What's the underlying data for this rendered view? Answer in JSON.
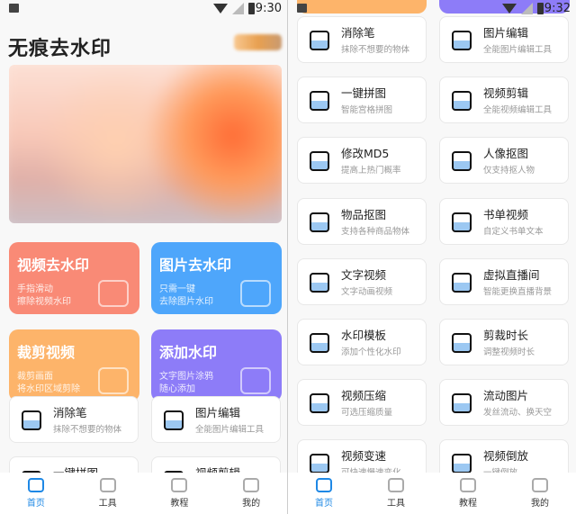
{
  "left": {
    "time": "9:30",
    "title": "无痕去水印"
  },
  "right": {
    "time": "9:32"
  },
  "features": [
    {
      "title": "视频去水印",
      "sub": "手指滑动\n擦除视频水印",
      "icon": "film-reel-icon",
      "color": "#f98a76"
    },
    {
      "title": "图片去水印",
      "sub": "只需一键\n去除图片水印",
      "icon": "image-icon",
      "color": "#4ea6fb"
    },
    {
      "title": "裁剪视频",
      "sub": "裁剪画面\n将水印区域剪除",
      "icon": "scissors-icon",
      "color": "#fdb46a"
    },
    {
      "title": "添加水印",
      "sub": "文字图片涂鸦\n随心添加",
      "icon": "pen-icon",
      "color": "#8d7cf8"
    }
  ],
  "tools": [
    {
      "name": "消除笔",
      "sub": "抹除不想要的物体",
      "icon": "eraser-icon"
    },
    {
      "name": "图片编辑",
      "sub": "全能图片编辑工具",
      "icon": "image-edit-icon"
    },
    {
      "name": "一键拼图",
      "sub": "智能宫格拼图",
      "icon": "collage-icon"
    },
    {
      "name": "视频剪辑",
      "sub": "全能视频编辑工具",
      "icon": "video-cut-icon"
    },
    {
      "name": "修改MD5",
      "sub": "提高上热门概率",
      "icon": "md5-icon"
    },
    {
      "name": "人像抠图",
      "sub": "仅支持抠人物",
      "icon": "portrait-icon"
    },
    {
      "name": "物品抠图",
      "sub": "支持各种商品物体",
      "icon": "bag-icon"
    },
    {
      "name": "书单视频",
      "sub": "自定义书单文本",
      "icon": "book-icon"
    },
    {
      "name": "文字视频",
      "sub": "文字动画视频",
      "icon": "text-video-icon"
    },
    {
      "name": "虚拟直播间",
      "sub": "智能更换直播背景",
      "icon": "tv-icon"
    },
    {
      "name": "水印模板",
      "sub": "添加个性化水印",
      "icon": "gear-icon"
    },
    {
      "name": "剪裁时长",
      "sub": "调整视频时长",
      "icon": "clock-icon"
    },
    {
      "name": "视频压缩",
      "sub": "可选压缩质量",
      "icon": "compress-icon"
    },
    {
      "name": "流动图片",
      "sub": "发丝流动、换天空",
      "icon": "flow-image-icon"
    },
    {
      "name": "视频变速",
      "sub": "可快速慢速变化",
      "icon": "speed-icon"
    },
    {
      "name": "视频倒放",
      "sub": "一键倒放",
      "icon": "rewind-icon"
    }
  ],
  "nav": [
    {
      "label": "首页",
      "icon": "home-icon",
      "active": true
    },
    {
      "label": "工具",
      "icon": "tools-icon"
    },
    {
      "label": "教程",
      "icon": "tutorial-play-icon"
    },
    {
      "label": "我的",
      "icon": "profile-icon"
    }
  ]
}
